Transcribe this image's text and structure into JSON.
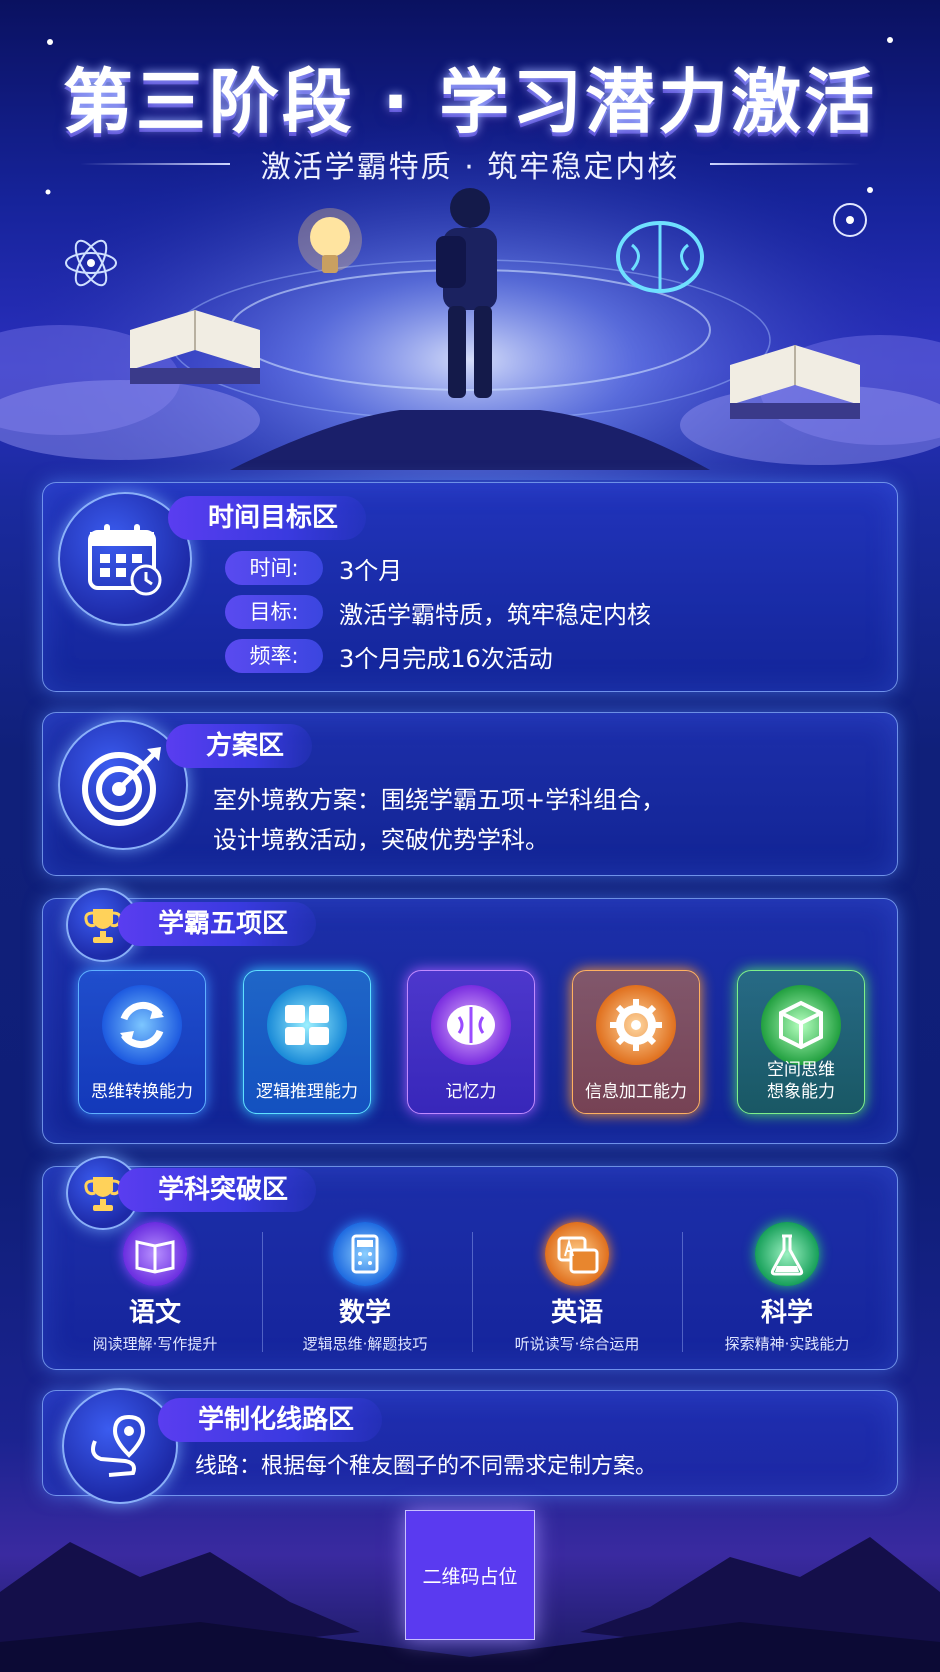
{
  "header": {
    "title": "第三阶段 · 学习潜力激活",
    "subtitle": "激活学霸特质 · 筑牢稳定内核"
  },
  "time_section": {
    "title": "时间目标区",
    "rows": [
      {
        "key": "时间:",
        "value": "3个月"
      },
      {
        "key": "目标:",
        "value": "激活学霸特质，筑牢稳定内核"
      },
      {
        "key": "频率:",
        "value": "3个月完成16次活动"
      }
    ]
  },
  "plan_section": {
    "title": "方案区",
    "line1": "室外境教方案：围绕学霸五项+学科组合，",
    "line2": "设计境教活动，突破优势学科。"
  },
  "skills_section": {
    "title": "学霸五项区",
    "items": [
      {
        "label": "思维转换能力",
        "icon": "rotate-arrows-icon",
        "color": "#3fa0ff"
      },
      {
        "label": "逻辑推理能力",
        "icon": "puzzle-icon",
        "color": "#36d6ff"
      },
      {
        "label": "记忆力",
        "icon": "brain-icon",
        "color": "#b06bff"
      },
      {
        "label": "信息加工能力",
        "icon": "gear-icon",
        "color": "#ff9a2e"
      },
      {
        "label": "空间思维",
        "label2": "想象能力",
        "icon": "cube-icon",
        "color": "#4ee06a"
      }
    ]
  },
  "subjects_section": {
    "title": "学科突破区",
    "items": [
      {
        "name": "语文",
        "desc": "阅读理解·写作提升",
        "icon": "book-icon",
        "color": "#8a4bff"
      },
      {
        "name": "数学",
        "desc": "逻辑思维·解题技巧",
        "icon": "calculator-icon",
        "color": "#2e8cff"
      },
      {
        "name": "英语",
        "desc": "听说读写·综合运用",
        "icon": "abc-icon",
        "color": "#ff8a2a"
      },
      {
        "name": "科学",
        "desc": "探索精神·实践能力",
        "icon": "flask-icon",
        "color": "#2ec27a"
      }
    ]
  },
  "route_section": {
    "title": "学制化线路区",
    "text": "线路：根据每个稚友圈子的不同需求定制方案。"
  },
  "qr": {
    "label": "二维码占位"
  }
}
